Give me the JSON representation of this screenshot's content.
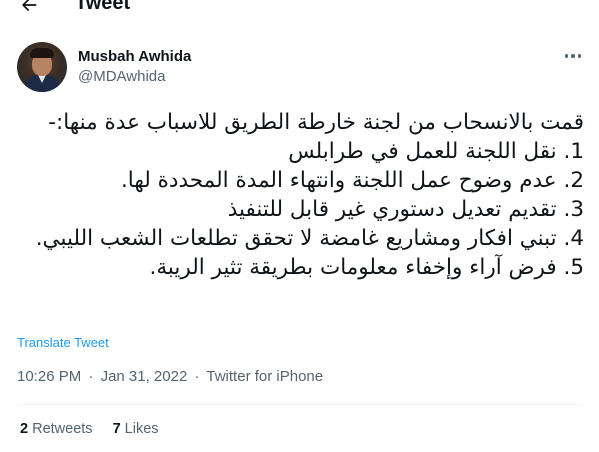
{
  "header": {
    "title": "Tweet"
  },
  "author": {
    "name": "Musbah Awhida",
    "handle": "@MDAwhida"
  },
  "tweet": {
    "lines": [
      "قمت بالانسحاب من لجنة خارطة الطريق للاسباب عدة منها:-",
      "1. نقل اللجنة للعمل في طرابلس",
      "2. عدم وضوح عمل اللجنة وانتهاء المدة المحددة لها.",
      "3. تقديم تعديل دستوري غير قابل للتنفيذ",
      "4. تبني افكار ومشاريع غامضة لا تحقق تطلعات الشعب الليبي.",
      "5. فرض آراء وإخفاء معلومات بطريقة تثير الريبة."
    ],
    "translate_label": "Translate Tweet"
  },
  "meta": {
    "time": "10:26 PM",
    "separator": "·",
    "date": "Jan 31, 2022",
    "source": "Twitter for iPhone"
  },
  "stats": {
    "retweets_count": "2",
    "retweets_label": "Retweets",
    "likes_count": "7",
    "likes_label": "Likes"
  },
  "icons": {
    "back": "arrow-left-icon",
    "more": "more-icon"
  },
  "colors": {
    "link": "#1d9bf0",
    "secondary_text": "#536471",
    "primary_text": "#0f1419"
  }
}
